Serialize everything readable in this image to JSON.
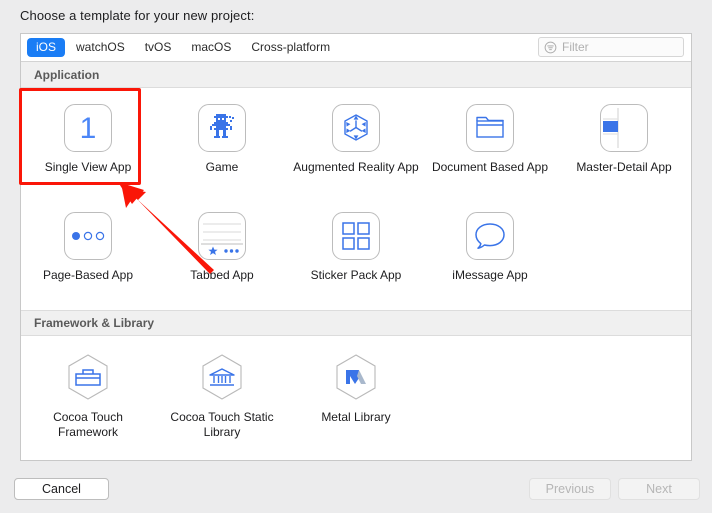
{
  "prompt": "Choose a template for your new project:",
  "tabs": [
    {
      "label": "iOS",
      "active": true
    },
    {
      "label": "watchOS",
      "active": false
    },
    {
      "label": "tvOS",
      "active": false
    },
    {
      "label": "macOS",
      "active": false
    },
    {
      "label": "Cross-platform",
      "active": false
    }
  ],
  "filter": {
    "placeholder": "Filter",
    "value": "",
    "icon": "filter-icon"
  },
  "sections": [
    {
      "title": "Application",
      "items": [
        {
          "label": "Single View App",
          "icon": "single-view-icon",
          "selected": true
        },
        {
          "label": "Game",
          "icon": "game-robot-icon",
          "selected": false
        },
        {
          "label": "Augmented Reality App",
          "icon": "augmented-reality-cube-icon",
          "selected": false
        },
        {
          "label": "Document Based App",
          "icon": "document-folder-icon",
          "selected": false
        },
        {
          "label": "Master-Detail App",
          "icon": "master-detail-split-icon",
          "selected": false
        },
        {
          "label": "Page-Based App",
          "icon": "page-dots-icon",
          "selected": false
        },
        {
          "label": "Tabbed App",
          "icon": "tab-bar-icon",
          "selected": false
        },
        {
          "label": "Sticker Pack App",
          "icon": "sticker-grid-icon",
          "selected": false
        },
        {
          "label": "iMessage App",
          "icon": "message-bubble-icon",
          "selected": false
        }
      ]
    },
    {
      "title": "Framework & Library",
      "items": [
        {
          "label": "Cocoa Touch Framework",
          "icon": "toolbox-hexagon-icon",
          "selected": false
        },
        {
          "label": "Cocoa Touch Static Library",
          "icon": "library-building-hexagon-icon",
          "selected": false
        },
        {
          "label": "Metal Library",
          "icon": "metal-m-hexagon-icon",
          "selected": false
        }
      ]
    }
  ],
  "buttons": {
    "cancel": "Cancel",
    "previous": "Previous",
    "next": "Next"
  },
  "annotation": {
    "highlight_color": "#fa1608",
    "arrow_color": "#fa1608",
    "target": "Single View App"
  },
  "colors": {
    "accent_blue": "#1a7df5",
    "icon_blue": "#3a74e8",
    "window_bg": "#ececed",
    "panel_bg": "#ffffff",
    "section_bg": "#f0f0f0"
  }
}
